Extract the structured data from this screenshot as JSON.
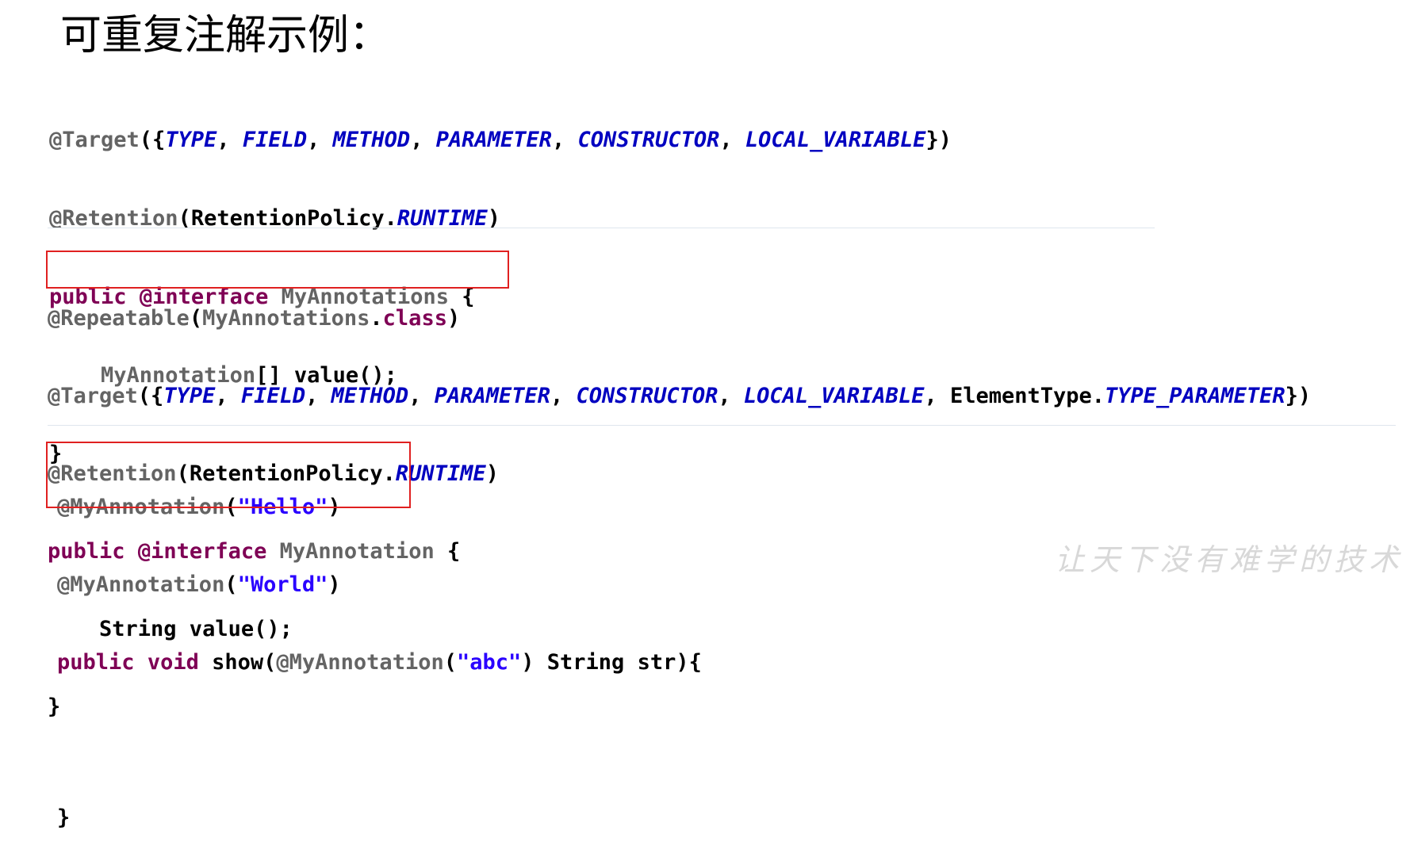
{
  "title": "可重复注解示例：",
  "watermark": "让天下没有难学的技术",
  "colors": {
    "annotation": "#646464",
    "keyword": "#7f0055",
    "constant": "#0000c0",
    "string": "#2a00ff",
    "highlight_box": "#e02020"
  },
  "block1": {
    "l1": {
      "a": "@Target",
      "b": "({",
      "c1": "TYPE",
      "s1": ", ",
      "c2": "FIELD",
      "s2": ", ",
      "c3": "METHOD",
      "s3": ", ",
      "c4": "PARAMETER",
      "s4": ", ",
      "c5": "CONSTRUCTOR",
      "s5": ", ",
      "c6": "LOCAL_VARIABLE",
      "e": "})"
    },
    "l2": {
      "a": "@Retention",
      "b": "(RetentionPolicy.",
      "c": "RUNTIME",
      "e": ")"
    },
    "l3": {
      "k1": "public",
      "sp": " ",
      "k2": "@interface",
      "sp2": " ",
      "n": "MyAnnotations",
      "e": " {"
    },
    "l4": {
      "ind": "    ",
      "n": "MyAnnotation",
      "e": "[] value();"
    },
    "l5": "}"
  },
  "block2": {
    "l1": {
      "a": "@Repeatable",
      "b": "(",
      "n": "MyAnnotations",
      "d": ".",
      "k": "class",
      "e": ")"
    },
    "l2": {
      "a": "@Target",
      "b": "({",
      "c1": "TYPE",
      "s1": ", ",
      "c2": "FIELD",
      "s2": ", ",
      "c3": "METHOD",
      "s3": ", ",
      "c4": "PARAMETER",
      "s4": ", ",
      "c5": "CONSTRUCTOR",
      "s5": ", ",
      "c6": "LOCAL_VARIABLE",
      "s6": ", ElementType.",
      "c7": "TYPE_PARAMETER",
      "e": "})"
    },
    "l3": {
      "a": "@Retention",
      "b": "(RetentionPolicy.",
      "c": "RUNTIME",
      "e": ")"
    },
    "l4": {
      "k1": "public",
      "sp": " ",
      "k2": "@interface",
      "sp2": " ",
      "n": "MyAnnotation",
      "e": " {"
    },
    "l5": "    String value();",
    "l6": "}"
  },
  "block3": {
    "l1": {
      "a": "@MyAnnotation",
      "b": "(",
      "s": "\"Hello\"",
      "e": ")"
    },
    "l2": {
      "a": "@MyAnnotation",
      "b": "(",
      "s": "\"World\"",
      "e": ")"
    },
    "l3": {
      "k1": "public",
      "sp": " ",
      "k2": "void",
      "m": " show(",
      "a": "@MyAnnotation",
      "b": "(",
      "s": "\"abc\"",
      "e": ") String str){"
    },
    "l4": "",
    "l5": "}"
  }
}
